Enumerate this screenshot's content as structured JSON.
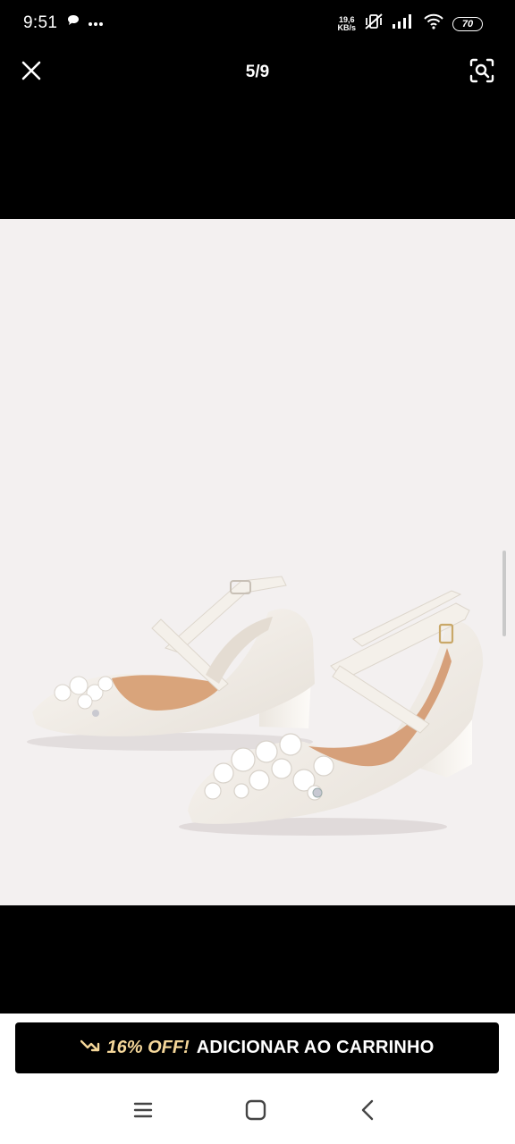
{
  "status_bar": {
    "time": "9:51",
    "speed_value": "19,6",
    "speed_unit": "KB/s",
    "battery": "70",
    "icons": [
      "chat-bubble-icon",
      "more-dots-icon",
      "mute-vibrate-icon",
      "signal-icon",
      "wifi-icon",
      "battery-icon"
    ]
  },
  "top_bar": {
    "page_counter": "5/9",
    "close_icon": "close-icon",
    "search_icon": "image-search-icon"
  },
  "cta": {
    "discount_label": "16% OFF!",
    "label": "ADICIONAR AO CARRINHO",
    "icon": "trending-down-icon",
    "discount_color": "#f5d79a"
  },
  "nav_bar": {
    "icons": [
      "recents-icon",
      "home-icon",
      "back-icon"
    ]
  }
}
